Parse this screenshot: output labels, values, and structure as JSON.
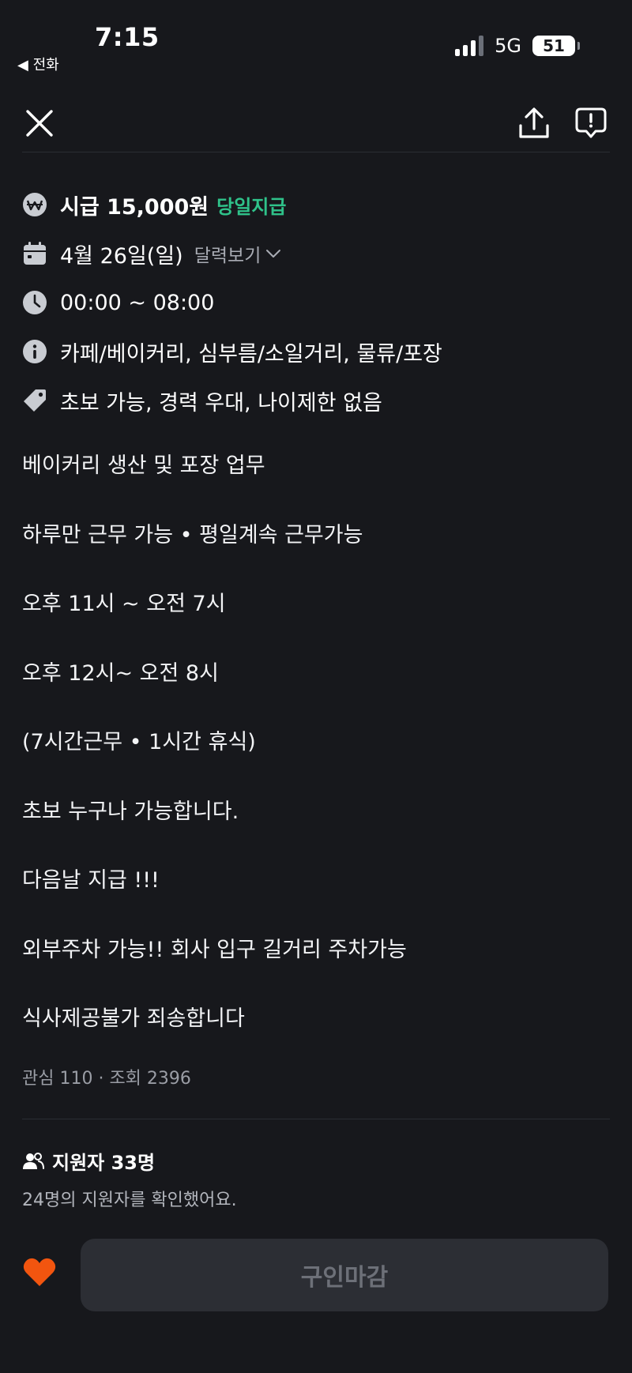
{
  "status_bar": {
    "time": "7:15",
    "back_label": "◀ 전화",
    "network": "5G",
    "battery": "51"
  },
  "icons": {
    "close": "close-icon",
    "share": "share-icon",
    "report": "report-icon",
    "wage": "won-icon",
    "date": "calendar-icon",
    "time": "clock-icon",
    "category": "info-icon",
    "tags": "tag-icon",
    "applicants": "people-icon",
    "like": "heart-icon"
  },
  "colors": {
    "background": "#17181c",
    "pay_badge": "#2fc28a",
    "heart": "#f2550f",
    "closed_button_bg": "#2c2e34"
  },
  "job": {
    "wage": "시급 15,000원",
    "pay_type": "당일지급",
    "date": "4월 26일(일)",
    "calendar_link": "달력보기",
    "time": "00:00 ~ 08:00",
    "categories": "카페/베이커리, 심부름/소일거리, 물류/포장",
    "tags": "초보 가능, 경력 우대, 나이제한 없음"
  },
  "description": [
    "베이커리 생산 및 포장 업무",
    "하루만 근무 가능 • 평일계속 근무가능",
    "오후 11시 ~ 오전 7시",
    "오후 12시~ 오전 8시",
    "(7시간근무 • 1시간 휴식)",
    "초보 누구나 가능합니다.",
    "다음날 지급 !!!",
    "외부주차 가능!! 회사 입구 길거리 주차가능",
    "식사제공불가 죄송합니다"
  ],
  "stats": "관심 110 · 조회 2396",
  "applicants": {
    "title": "지원자 33명",
    "subtitle": "24명의 지원자를 확인했어요."
  },
  "bottom": {
    "status_button": "구인마감"
  }
}
